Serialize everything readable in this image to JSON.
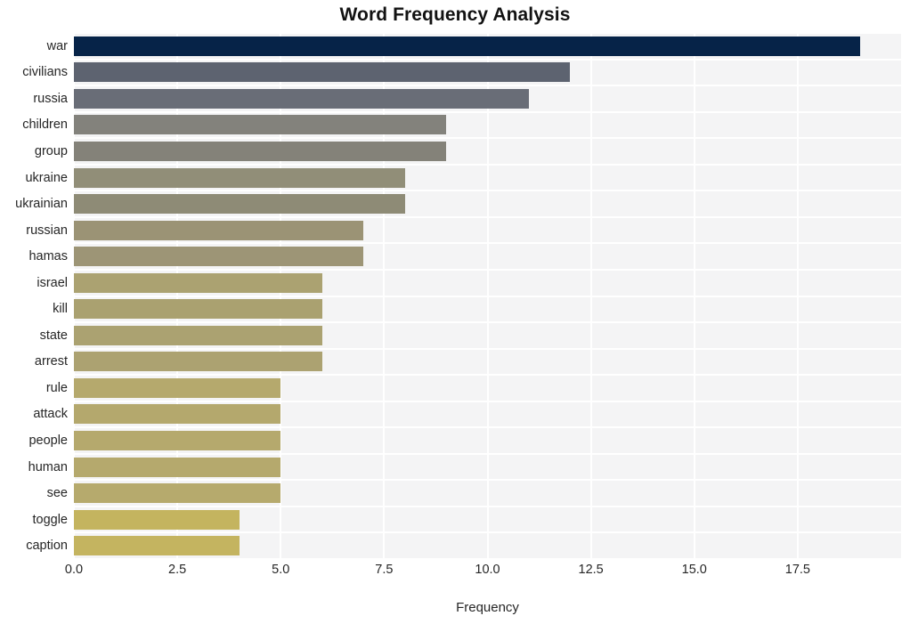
{
  "chart_data": {
    "type": "bar",
    "orientation": "horizontal",
    "title": "Word Frequency Analysis",
    "xlabel": "Frequency",
    "ylabel": "",
    "xlim": [
      0,
      20
    ],
    "ylim": [
      0,
      20
    ],
    "grid": true,
    "legend": null,
    "xticks": [
      "0.0",
      "2.5",
      "5.0",
      "7.5",
      "10.0",
      "12.5",
      "15.0",
      "17.5"
    ],
    "xtick_values": [
      0.0,
      2.5,
      5.0,
      7.5,
      10.0,
      12.5,
      15.0,
      17.5
    ],
    "categories": [
      "war",
      "civilians",
      "russia",
      "children",
      "group",
      "ukraine",
      "ukrainian",
      "russian",
      "hamas",
      "israel",
      "kill",
      "state",
      "arrest",
      "rule",
      "attack",
      "people",
      "human",
      "see",
      "toggle",
      "caption"
    ],
    "values": [
      19,
      12,
      11,
      9,
      9,
      8,
      8,
      7,
      7,
      6,
      6,
      6,
      6,
      5,
      5,
      5,
      5,
      5,
      4,
      4
    ],
    "colors": [
      "#062348",
      "#5d6370",
      "#696d77",
      "#83827c",
      "#848279",
      "#918e78",
      "#8e8b76",
      "#9b9375",
      "#9d9576",
      "#aba271",
      "#aaa170",
      "#aba271",
      "#aca271",
      "#b5a96d",
      "#b4a86d",
      "#b5a96d",
      "#b5a96d",
      "#b6aa6d",
      "#c4b45f",
      "#c4b460"
    ],
    "plot_background": "#f4f4f5",
    "gridline_color": "#ffffff"
  }
}
